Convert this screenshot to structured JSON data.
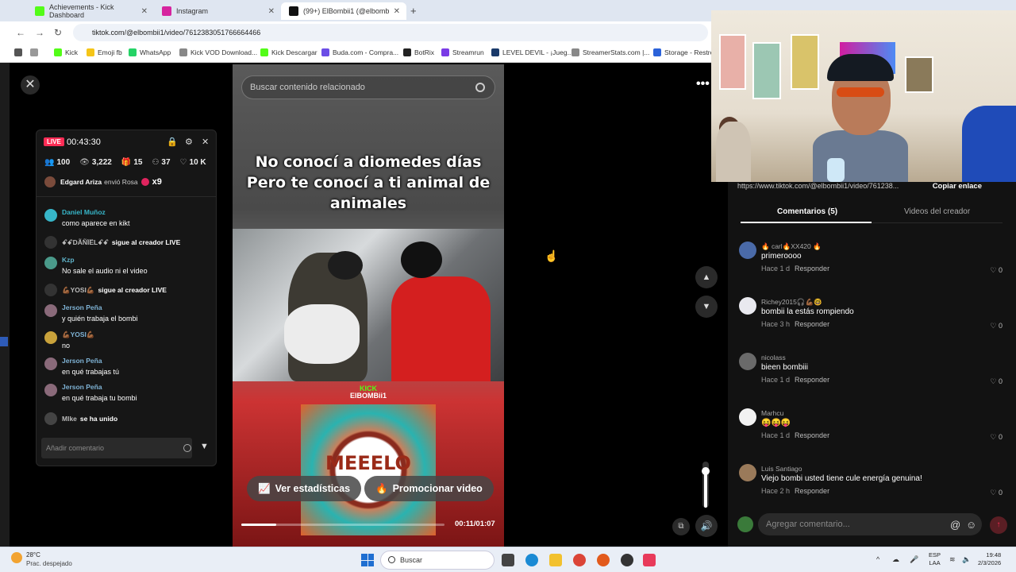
{
  "browser": {
    "tabs": [
      {
        "label": "Achievements - Kick Dashboard",
        "color": "#53fc18"
      },
      {
        "label": "Instagram",
        "color": "#d6249f"
      },
      {
        "label": "(99+) ElBombii1 (@elbomb",
        "color": "#111111"
      }
    ],
    "url": "tiktok.com/@elbombii1/video/7612383051766664466",
    "bookmarks": [
      {
        "label": "Kick",
        "color": "#53fc18"
      },
      {
        "label": "Emoji fb",
        "color": "#f5c518"
      },
      {
        "label": "WhatsApp",
        "color": "#25d366"
      },
      {
        "label": "Kick VOD Download...",
        "color": "#888888"
      },
      {
        "label": "Kick Descargar",
        "color": "#53fc18"
      },
      {
        "label": "Buda.com - Compra...",
        "color": "#6b4de6"
      },
      {
        "label": "BotRix",
        "color": "#222222"
      },
      {
        "label": "Streamrun",
        "color": "#7a3be6"
      },
      {
        "label": "LEVEL DEVIL - ¡Jueg...",
        "color": "#1a3a6a"
      },
      {
        "label": "StreamerStats.com |...",
        "color": "#888888"
      },
      {
        "label": "Storage - Restre",
        "color": "#2b62d9"
      }
    ]
  },
  "video": {
    "search_placeholder": "Buscar contenido relacionado",
    "caption_line1": "No conocí a diomedes días",
    "caption_line2": "Pero te conocí a ti animal de animales",
    "watermark_brand": "KICK",
    "watermark_user": "ElBOMBii1",
    "album_text": "MEEELO",
    "stats_button": "Ver estadísticas",
    "promote_button": "Promocionar video",
    "time": "00:11/01:07",
    "progress": 0.17,
    "volume": 0.85
  },
  "live": {
    "badge": "LIVE",
    "duration": "00:43:30",
    "stats": {
      "users": "100",
      "views": "3,222",
      "gifts": "15",
      "shares": "37",
      "likes": "10 K"
    },
    "gift": {
      "user": "Edgard Ariza",
      "action": "envió Rosa",
      "count": "x9"
    },
    "chat": [
      {
        "type": "msg",
        "name": "Daniel Muñoz",
        "text": "como aparece en kikt",
        "color": "#37b6c9"
      },
      {
        "type": "sys",
        "name": "ꗃꗃDÃÑÏËLꗃꗃ",
        "text": "sigue al creador LIVE"
      },
      {
        "type": "msg",
        "name": "Kzp",
        "text": "No sale el audio ni el video",
        "color": "#4a9a8a"
      },
      {
        "type": "sys",
        "name": "💪🏾YOSI💪🏾",
        "text": "sigue al creador LIVE"
      },
      {
        "type": "msg",
        "name": "Jerson Peña",
        "text": "y quién trabaja el bombi",
        "color": "#8a6a7a"
      },
      {
        "type": "msg",
        "name": "💪🏾YOSI💪🏾",
        "text": "no",
        "color": "#c9a23b"
      },
      {
        "type": "msg",
        "name": "Jerson Peña",
        "text": "en qué trabajas tú",
        "color": "#8a6a7a"
      },
      {
        "type": "msg",
        "name": "Jerson Peña",
        "text": "en qué trabaja tu bombi",
        "color": "#8a6a7a"
      },
      {
        "type": "sys",
        "name": "Mlke",
        "text": "se ha unido"
      }
    ],
    "comment_placeholder": "Añadir comentario"
  },
  "comments_panel": {
    "link": "https://www.tiktok.com/@elbombii1/video/761238...",
    "copy_label": "Copiar enlace",
    "tab_comments": "Comentarios (5)",
    "tab_creator": "Videos del creador",
    "reply_label": "Responder",
    "comments": [
      {
        "name": "🔥 carl🔥XX420 🔥",
        "text": "primeroooo",
        "time": "Hace 1 d",
        "likes": "0",
        "color": "#4a6aa8"
      },
      {
        "name": "Richey2015🎧💪🏾🤓",
        "text": "bombii la estás rompiendo",
        "time": "Hace 3 h",
        "likes": "0",
        "color": "#e9e9ef"
      },
      {
        "name": "nicolass",
        "text": "bieen bombiii",
        "time": "Hace 1 d",
        "likes": "0",
        "color": "#6a6a6a"
      },
      {
        "name": "Marhcu",
        "text": "😝😝😝",
        "time": "Hace 1 d",
        "likes": "0",
        "color": "#f2f2f2"
      },
      {
        "name": "Luis Santiago",
        "text": "Viejo bombi usted tiene cule energía genuina!",
        "time": "Hace 2 h",
        "likes": "0",
        "color": "#9a7a5a"
      }
    ],
    "add_placeholder": "Agregar comentario..."
  },
  "taskbar": {
    "temp": "28°C",
    "weather": "Prac. despejado",
    "search": "Buscar",
    "lang1": "ESP",
    "lang2": "LAA",
    "time": "19:48",
    "date": "2/3/2026"
  }
}
